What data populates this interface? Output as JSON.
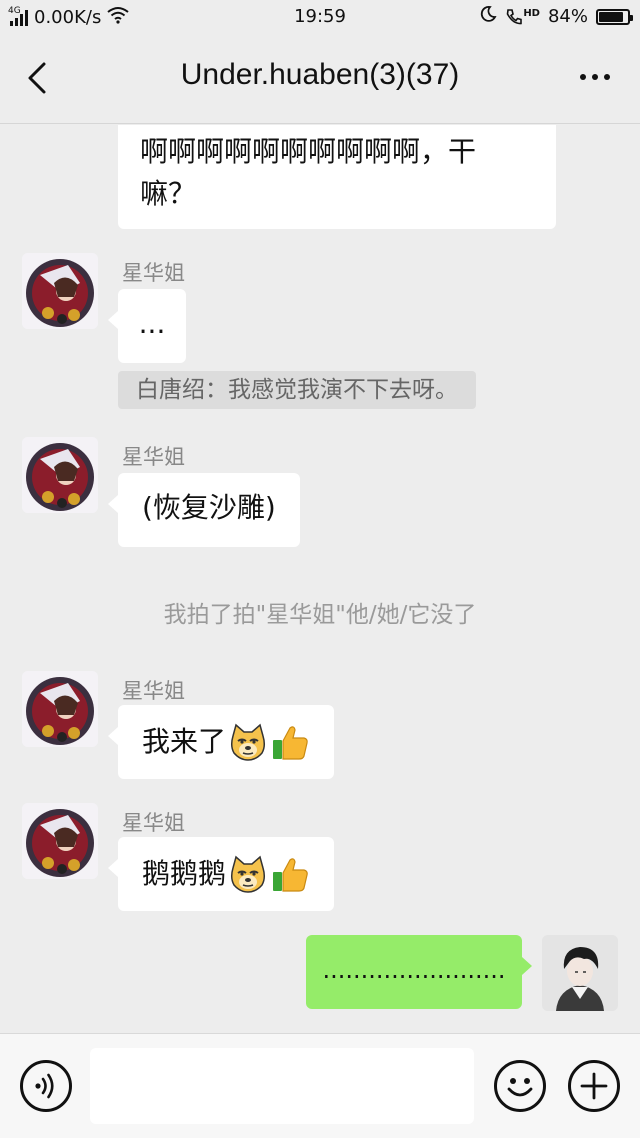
{
  "status_bar": {
    "network_type": "4G",
    "speed": "0.00K/s",
    "time": "19:59",
    "hd_label": "HD",
    "battery": "84%",
    "battery_level": 0.84
  },
  "header": {
    "title": "Under.huaben(3)(37)"
  },
  "messages": {
    "m1": {
      "text_line1": "啊啊啊啊啊啊啊啊啊啊，干",
      "text_line2": "嘛？"
    },
    "m2": {
      "sender": "星华姐",
      "text": "..."
    },
    "quote": "白唐绍：我感觉我演不下去呀。",
    "m3": {
      "sender": "星华姐",
      "text": "(恢复沙雕)"
    },
    "system": "我拍了拍\"星华姐\"他/她/它没了",
    "m4": {
      "sender": "星华姐",
      "text": "我来了"
    },
    "m5": {
      "sender": "星华姐",
      "text": "鹅鹅鹅"
    },
    "m6": {
      "text": "........................"
    }
  },
  "icons": {
    "back": "chevron-left-icon",
    "more": "more-dots-icon",
    "voice": "voice-icon",
    "emoji": "emoji-icon",
    "plus": "plus-icon",
    "doge": "doge-emoji",
    "thumbs_up": "thumbs-up-emoji"
  },
  "colors": {
    "background": "#ededed",
    "my_bubble": "#95ec69",
    "other_bubble": "#ffffff"
  },
  "input": {
    "value": ""
  }
}
